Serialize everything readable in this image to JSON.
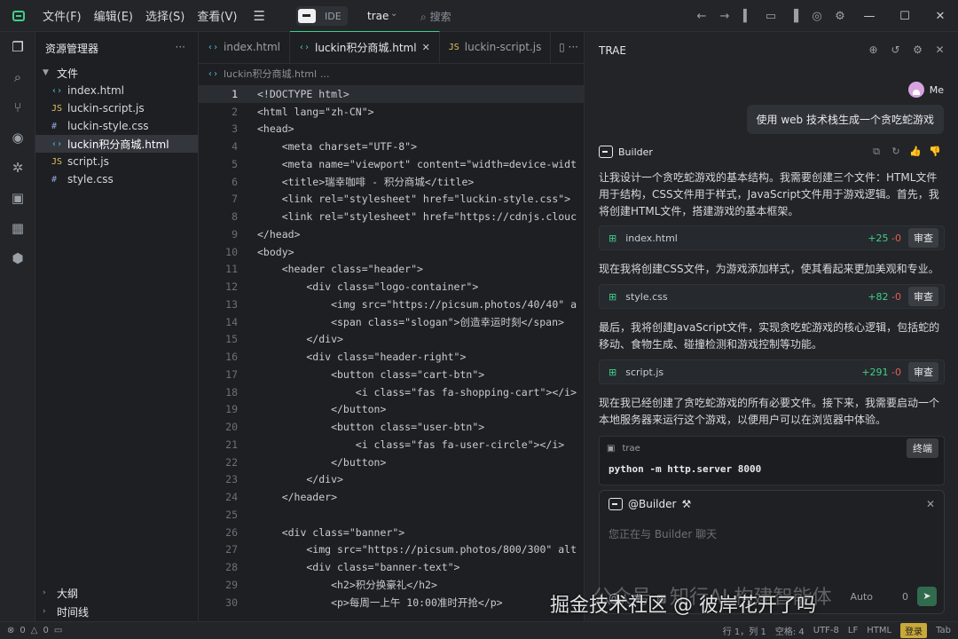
{
  "titlebar": {
    "menus": [
      "文件(F)",
      "编辑(E)",
      "选择(S)",
      "查看(V)"
    ],
    "ide_label": "IDE",
    "project": "trae",
    "search_placeholder": "搜索"
  },
  "explorer": {
    "title": "资源管理器",
    "folder": "文件",
    "files": [
      {
        "icon": "html",
        "name": "index.html"
      },
      {
        "icon": "js",
        "name": "luckin-script.js"
      },
      {
        "icon": "css",
        "name": "luckin-style.css"
      },
      {
        "icon": "html",
        "name": "luckin积分商城.html",
        "selected": true
      },
      {
        "icon": "js",
        "name": "script.js"
      },
      {
        "icon": "css",
        "name": "style.css"
      }
    ],
    "outline": "大纲",
    "timeline": "时间线"
  },
  "editor": {
    "tabs": [
      {
        "name": "index.html",
        "icon": "html"
      },
      {
        "name": "luckin积分商城.html",
        "icon": "html",
        "active": true
      },
      {
        "name": "luckin-script.js",
        "icon": "js"
      }
    ],
    "breadcrumb_file": "luckin积分商城.html",
    "breadcrumb_more": "...",
    "current_line": 1,
    "lines": [
      "<!DOCTYPE html>",
      "<html lang=\"zh-CN\">",
      "<head>",
      "    <meta charset=\"UTF-8\">",
      "    <meta name=\"viewport\" content=\"width=device-widt",
      "    <title>瑞幸咖啡 - 积分商城</title>",
      "    <link rel=\"stylesheet\" href=\"luckin-style.css\">",
      "    <link rel=\"stylesheet\" href=\"https://cdnjs.clouc",
      "</head>",
      "<body>",
      "    <header class=\"header\">",
      "        <div class=\"logo-container\">",
      "            <img src=\"https://picsum.photos/40/40\" a",
      "            <span class=\"slogan\">创造幸运时刻</span>",
      "        </div>",
      "        <div class=\"header-right\">",
      "            <button class=\"cart-btn\">",
      "                <i class=\"fas fa-shopping-cart\"></i>",
      "            </button>",
      "            <button class=\"user-btn\">",
      "                <i class=\"fas fa-user-circle\"></i>",
      "            </button>",
      "        </div>",
      "    </header>",
      "",
      "    <div class=\"banner\">",
      "        <img src=\"https://picsum.photos/800/300\" alt",
      "        <div class=\"banner-text\">",
      "            <h2>积分换豪礼</h2>",
      "            <p>每周一上午 10:00准时开抢</p>"
    ]
  },
  "chat": {
    "title": "TRAE",
    "user_name": "Me",
    "user_message": "使用 web 技术栈生成一个贪吃蛇游戏",
    "agent_name": "Builder",
    "messages": [
      "让我设计一个贪吃蛇游戏的基本结构。我需要创建三个文件：HTML文件用于结构，CSS文件用于样式，JavaScript文件用于游戏逻辑。首先，我将创建HTML文件，搭建游戏的基本框架。",
      "现在我将创建CSS文件，为游戏添加样式，使其看起来更加美观和专业。",
      "最后，我将创建JavaScript文件，实现贪吃蛇游戏的核心逻辑，包括蛇的移动、食物生成、碰撞检测和游戏控制等功能。",
      "现在我已经创建了贪吃蛇游戏的所有必要文件。接下来，我需要启动一个本地服务器来运行这个游戏，以便用户可以在浏览器中体验。"
    ],
    "file_cards": [
      {
        "name": "index.html",
        "added": "+25",
        "removed": "-0",
        "action": "审查"
      },
      {
        "name": "style.css",
        "added": "+82",
        "removed": "-0",
        "action": "审查"
      },
      {
        "name": "script.js",
        "added": "+291",
        "removed": "-0",
        "action": "审查"
      }
    ],
    "terminal": {
      "label": "trae",
      "button": "终端",
      "command": "python -m http.server 8000"
    },
    "composer": {
      "context": "@Builder",
      "placeholder": "您正在与 Builder 聊天",
      "model": "Auto",
      "tokens": "0"
    }
  },
  "watermark": "掘金技术社区 @ 彼岸花开了吗",
  "watermark_bg": "公众号 · 知行AI 构建智能体",
  "statusbar": {
    "errors": "0",
    "warnings": "0",
    "position": "行 1，列 1",
    "spaces": "空格: 4",
    "encoding": "UTF-8",
    "eol": "LF",
    "language": "HTML",
    "login": "登录",
    "tab": "Tab"
  }
}
